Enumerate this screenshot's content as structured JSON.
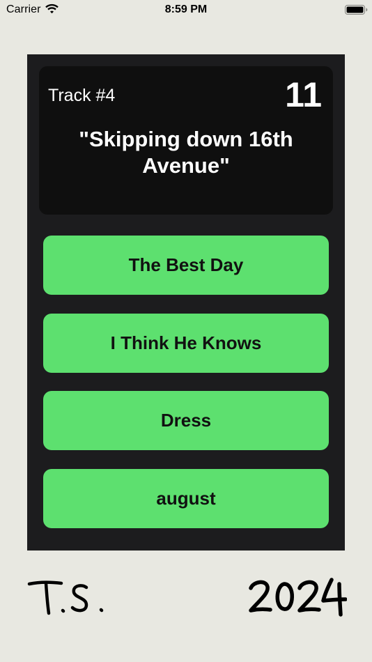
{
  "status_bar": {
    "carrier": "Carrier",
    "time": "8:59 PM",
    "wifi_icon": "wifi-icon",
    "battery_icon": "battery-full-icon"
  },
  "question": {
    "track_label": "Track #4",
    "countdown": "11",
    "lyric": "\"Skipping down 16th Avenue\""
  },
  "answers": [
    "The Best Day",
    "I Think He Knows",
    "Dress",
    "august"
  ],
  "footer": {
    "signature": "T.S.",
    "year": "2024"
  },
  "colors": {
    "background": "#e8e8e1",
    "card": "#1c1c1e",
    "header_panel": "#0f0f0f",
    "answer_button": "#5de06f"
  }
}
